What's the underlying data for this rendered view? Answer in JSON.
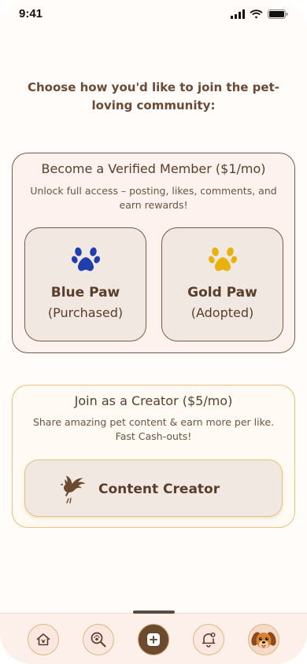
{
  "status_bar": {
    "time": "9:41"
  },
  "intro": {
    "text": "Choose how you'd like to join the pet-loving community:"
  },
  "verified": {
    "title": "Become a Verified Member ($1/mo)",
    "description": "Unlock full access – posting, likes, comments, and earn rewards!",
    "options": [
      {
        "name": "Blue Paw",
        "status": "(Purchased)",
        "icon": "paw-icon",
        "color": "#1f3fb0"
      },
      {
        "name": "Gold Paw",
        "status": "(Adopted)",
        "icon": "paw-icon",
        "color": "#e8b10e"
      }
    ]
  },
  "creator": {
    "title": "Join as a Creator ($5/mo)",
    "description": "Share amazing pet content & earn more per like. Fast Cash-outs!",
    "button_label": "Content Creator",
    "icon": "dove-icon"
  },
  "nav": {
    "items": [
      {
        "icon": "home-icon"
      },
      {
        "icon": "search-icon"
      },
      {
        "icon": "plus-icon"
      },
      {
        "icon": "notification-bell-icon"
      },
      {
        "icon": "profile-avatar"
      }
    ]
  },
  "colors": {
    "brown": "#5a3e2b",
    "gold": "#e5c371",
    "blue_paw": "#1f3fb0",
    "gold_paw": "#e8b10e"
  }
}
